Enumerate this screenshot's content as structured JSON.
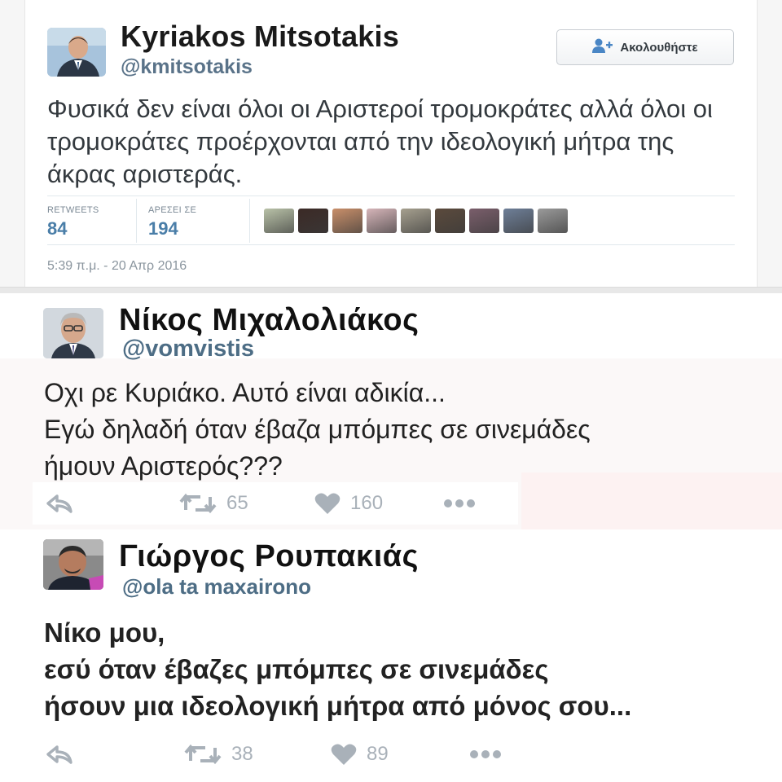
{
  "tweet1": {
    "name": "Kyriakos Mitsotakis",
    "handle": "@kmitsotakis",
    "follow_label": "Ακολουθήστε",
    "text": "Φυσικά δεν είναι όλοι οι Αριστεροί τρομοκράτες αλλά όλοι οι τρομοκράτες προέρχονται από την ιδεολογική μήτρα της άκρας αριστεράς.",
    "retweets_label": "RETWEETS",
    "retweets_value": "84",
    "likes_label": "ΑΡΕΣΕΙ ΣΕ",
    "likes_value": "194",
    "timestamp": "5:39 π.μ. - 20 Απρ 2016",
    "liker_colors": [
      "#b9c2a8",
      "#3b2a26",
      "#c98f6a",
      "#d6b5b9",
      "#a6a08f",
      "#5b4a3c",
      "#7a5e6b",
      "#6e7f98",
      "#9a9a9a"
    ],
    "accent": "#4a7ea8"
  },
  "tweet2": {
    "name": "Νίκος Μιχαλολιάκος",
    "handle": "@vomvistis",
    "text_lines": [
      "Οχι ρε Κυριάκο. Αυτό είναι αδικία...",
      "Εγώ δηλαδή όταν έβαζα μπόμπες σε σινεμάδες",
      "ήμουν Αριστερός???"
    ],
    "retweet_count": "65",
    "like_count": "160"
  },
  "tweet3": {
    "name": "Γιώργος Ρουπακιάς",
    "handle": "@ola ta maxairono",
    "text_lines": [
      "Νίκο μου,",
      "εσύ όταν έβαζες μπόμπες σε σινεμάδες",
      "ήσουν μια ιδεολογική μήτρα από μόνος σου..."
    ],
    "retweet_count": "38",
    "like_count": "89"
  },
  "icons": {
    "reply": "reply-icon",
    "retweet": "retweet-icon",
    "like": "heart-icon",
    "more": "more-icon",
    "follow": "add-user-icon"
  }
}
